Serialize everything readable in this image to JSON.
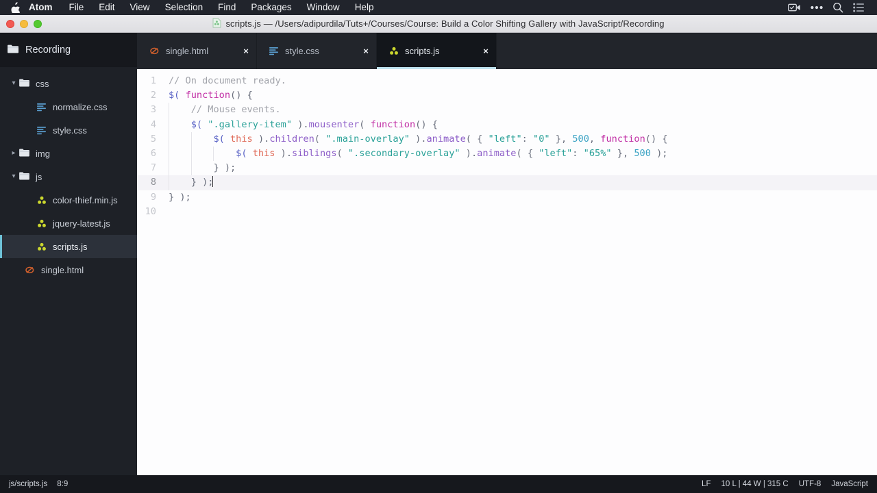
{
  "menubar": {
    "apple_icon": "apple-logo-icon",
    "items": [
      {
        "label": "Atom",
        "bold": true
      },
      {
        "label": "File",
        "bold": false
      },
      {
        "label": "Edit",
        "bold": false
      },
      {
        "label": "View",
        "bold": false
      },
      {
        "label": "Selection",
        "bold": false
      },
      {
        "label": "Find",
        "bold": false
      },
      {
        "label": "Packages",
        "bold": false
      },
      {
        "label": "Window",
        "bold": false
      },
      {
        "label": "Help",
        "bold": false
      }
    ],
    "right_icons": [
      "screen-recording-icon",
      "ellipsis-icon",
      "search-icon",
      "control-center-icon"
    ]
  },
  "titlebar": {
    "title": "scripts.js — /Users/adipurdila/Tuts+/Courses/Course: Build a Color Shifting Gallery with JavaScript/Recording",
    "file_icon": "javascript-file-icon",
    "traffic_lights": [
      "close-button",
      "minimize-button",
      "zoom-button"
    ]
  },
  "sidebar": {
    "project_name": "Recording",
    "project_icon": "folder-icon",
    "tree": [
      {
        "label": "css",
        "type": "folder",
        "icon": "folder-icon",
        "expanded": true,
        "depth": 0,
        "selected": false
      },
      {
        "label": "normalize.css",
        "type": "file",
        "icon": "css-file-icon",
        "expanded": null,
        "depth": 1,
        "selected": false
      },
      {
        "label": "style.css",
        "type": "file",
        "icon": "css-file-icon",
        "expanded": null,
        "depth": 1,
        "selected": false
      },
      {
        "label": "img",
        "type": "folder",
        "icon": "folder-icon",
        "expanded": false,
        "depth": 0,
        "selected": false
      },
      {
        "label": "js",
        "type": "folder",
        "icon": "folder-icon",
        "expanded": true,
        "depth": 0,
        "selected": false
      },
      {
        "label": "color-thief.min.js",
        "type": "file",
        "icon": "javascript-file-icon",
        "expanded": null,
        "depth": 1,
        "selected": false
      },
      {
        "label": "jquery-latest.js",
        "type": "file",
        "icon": "javascript-file-icon",
        "expanded": null,
        "depth": 1,
        "selected": false
      },
      {
        "label": "scripts.js",
        "type": "file",
        "icon": "javascript-file-icon",
        "expanded": null,
        "depth": 1,
        "selected": true
      },
      {
        "label": "single.html",
        "type": "file",
        "icon": "html-file-icon",
        "expanded": null,
        "depth": 0,
        "selected": false
      }
    ]
  },
  "tabs": [
    {
      "label": "single.html",
      "icon": "html-file-icon",
      "active": false,
      "close_label": "×"
    },
    {
      "label": "style.css",
      "icon": "css-file-icon",
      "active": false,
      "close_label": "×"
    },
    {
      "label": "scripts.js",
      "icon": "javascript-file-icon",
      "active": true,
      "close_label": "×"
    }
  ],
  "editor": {
    "active_line": 8,
    "cursor_line": 8,
    "line_numbers": [
      "1",
      "2",
      "3",
      "4",
      "5",
      "6",
      "7",
      "8",
      "9",
      "10"
    ],
    "lines": [
      {
        "n": "1",
        "indent": 0,
        "tokens": [
          {
            "t": "comment",
            "v": "// On document ready."
          }
        ]
      },
      {
        "n": "2",
        "indent": 0,
        "tokens": [
          {
            "t": "dollar",
            "v": "$("
          },
          {
            "t": "plain",
            "v": " "
          },
          {
            "t": "kw",
            "v": "function"
          },
          {
            "t": "paren",
            "v": "()"
          },
          {
            "t": "plain",
            "v": " "
          },
          {
            "t": "paren",
            "v": "{"
          }
        ]
      },
      {
        "n": "3",
        "indent": 1,
        "tokens": [
          {
            "t": "comment",
            "v": "// Mouse events."
          }
        ]
      },
      {
        "n": "4",
        "indent": 1,
        "tokens": [
          {
            "t": "dollar",
            "v": "$("
          },
          {
            "t": "plain",
            "v": " "
          },
          {
            "t": "string",
            "v": "\".gallery-item\""
          },
          {
            "t": "plain",
            "v": " "
          },
          {
            "t": "paren",
            "v": ")."
          },
          {
            "t": "method",
            "v": "mousenter"
          },
          {
            "t": "paren",
            "v": "("
          },
          {
            "t": "plain",
            "v": " "
          },
          {
            "t": "kw",
            "v": "function"
          },
          {
            "t": "paren",
            "v": "()"
          },
          {
            "t": "plain",
            "v": " "
          },
          {
            "t": "paren",
            "v": "{"
          }
        ]
      },
      {
        "n": "5",
        "indent": 2,
        "tokens": [
          {
            "t": "dollar",
            "v": "$("
          },
          {
            "t": "plain",
            "v": " "
          },
          {
            "t": "this",
            "v": "this"
          },
          {
            "t": "plain",
            "v": " "
          },
          {
            "t": "paren",
            "v": ")."
          },
          {
            "t": "method",
            "v": "children"
          },
          {
            "t": "paren",
            "v": "("
          },
          {
            "t": "plain",
            "v": " "
          },
          {
            "t": "string",
            "v": "\".main-overlay\""
          },
          {
            "t": "plain",
            "v": " "
          },
          {
            "t": "paren",
            "v": ")."
          },
          {
            "t": "method",
            "v": "animate"
          },
          {
            "t": "paren",
            "v": "("
          },
          {
            "t": "plain",
            "v": " "
          },
          {
            "t": "paren",
            "v": "{"
          },
          {
            "t": "plain",
            "v": " "
          },
          {
            "t": "string",
            "v": "\"left\""
          },
          {
            "t": "paren",
            "v": ":"
          },
          {
            "t": "plain",
            "v": " "
          },
          {
            "t": "string",
            "v": "\"0\""
          },
          {
            "t": "plain",
            "v": " "
          },
          {
            "t": "paren",
            "v": "}"
          },
          {
            "t": "paren",
            "v": ","
          },
          {
            "t": "plain",
            "v": " "
          },
          {
            "t": "num",
            "v": "500"
          },
          {
            "t": "paren",
            "v": ","
          },
          {
            "t": "plain",
            "v": " "
          },
          {
            "t": "kw",
            "v": "function"
          },
          {
            "t": "paren",
            "v": "()"
          },
          {
            "t": "plain",
            "v": " "
          },
          {
            "t": "paren",
            "v": "{"
          }
        ]
      },
      {
        "n": "6",
        "indent": 3,
        "tokens": [
          {
            "t": "dollar",
            "v": "$("
          },
          {
            "t": "plain",
            "v": " "
          },
          {
            "t": "this",
            "v": "this"
          },
          {
            "t": "plain",
            "v": " "
          },
          {
            "t": "paren",
            "v": ")."
          },
          {
            "t": "method",
            "v": "siblings"
          },
          {
            "t": "paren",
            "v": "("
          },
          {
            "t": "plain",
            "v": " "
          },
          {
            "t": "string",
            "v": "\".secondary-overlay\""
          },
          {
            "t": "plain",
            "v": " "
          },
          {
            "t": "paren",
            "v": ")."
          },
          {
            "t": "method",
            "v": "animate"
          },
          {
            "t": "paren",
            "v": "("
          },
          {
            "t": "plain",
            "v": " "
          },
          {
            "t": "paren",
            "v": "{"
          },
          {
            "t": "plain",
            "v": " "
          },
          {
            "t": "string",
            "v": "\"left\""
          },
          {
            "t": "paren",
            "v": ":"
          },
          {
            "t": "plain",
            "v": " "
          },
          {
            "t": "string",
            "v": "\"65%\""
          },
          {
            "t": "plain",
            "v": " "
          },
          {
            "t": "paren",
            "v": "}"
          },
          {
            "t": "paren",
            "v": ","
          },
          {
            "t": "plain",
            "v": " "
          },
          {
            "t": "num",
            "v": "500"
          },
          {
            "t": "plain",
            "v": " "
          },
          {
            "t": "paren",
            "v": ");"
          }
        ]
      },
      {
        "n": "7",
        "indent": 2,
        "tokens": [
          {
            "t": "paren",
            "v": "}"
          },
          {
            "t": "plain",
            "v": " "
          },
          {
            "t": "paren",
            "v": ");"
          }
        ]
      },
      {
        "n": "8",
        "indent": 1,
        "tokens": [
          {
            "t": "paren",
            "v": "}"
          },
          {
            "t": "plain",
            "v": " "
          },
          {
            "t": "paren",
            "v": ");"
          }
        ]
      },
      {
        "n": "9",
        "indent": 0,
        "tokens": [
          {
            "t": "paren",
            "v": "}"
          },
          {
            "t": "plain",
            "v": " "
          },
          {
            "t": "paren",
            "v": ");"
          }
        ]
      },
      {
        "n": "10",
        "indent": 0,
        "tokens": []
      }
    ]
  },
  "statusbar": {
    "file_path": "js/scripts.js",
    "cursor_position": "8:9",
    "line_ending": "LF",
    "counts": "10 L | 44 W | 315 C",
    "encoding": "UTF-8",
    "grammar": "JavaScript"
  },
  "colors": {
    "accent": "#bfe3ef",
    "selection": "#2c313a",
    "sidebar_bg": "#1e2127",
    "editor_bg": "#fdfdfe",
    "js_icon": "#cbd72e",
    "css_icon": "#5a9ecf",
    "html_icon": "#d2602c"
  }
}
